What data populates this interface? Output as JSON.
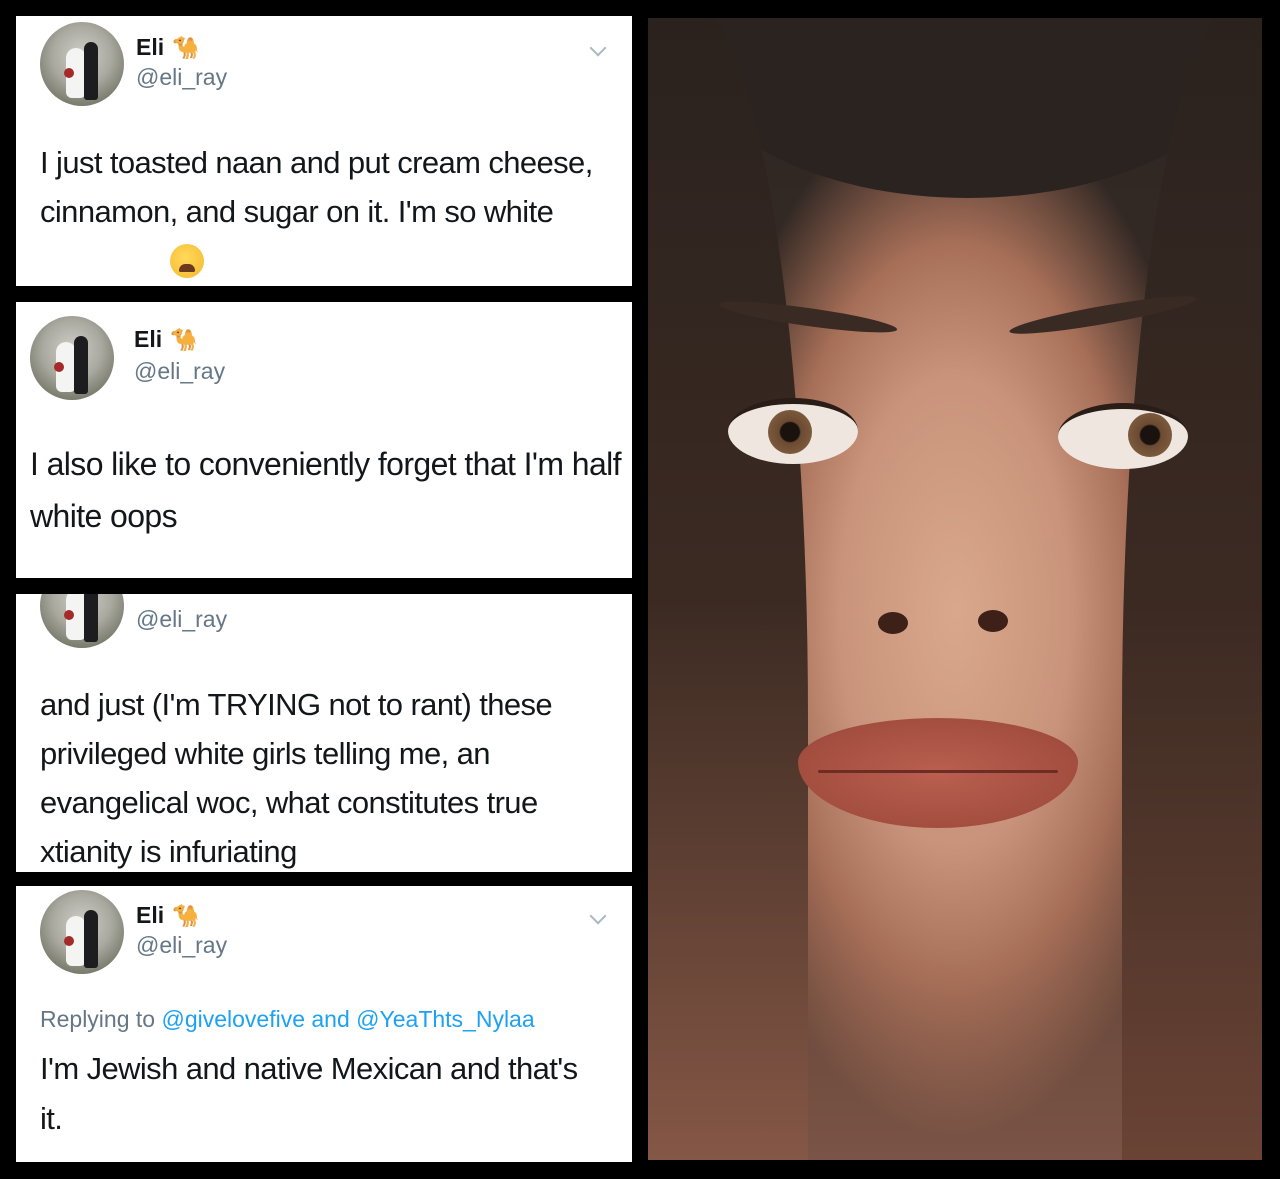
{
  "tweets": [
    {
      "name": "Eli",
      "camel": "🐪",
      "handle": "@eli_ray",
      "text": "I just toasted naan and put cream cheese, cinnamon, and sugar on it. I'm so white"
    },
    {
      "name": "Eli",
      "camel": "🐪",
      "handle": "@eli_ray",
      "text": "I also like to conveniently forget that I'm half white oops"
    },
    {
      "handle": "@eli_ray",
      "text": "and just (I'm TRYING not to rant) these privileged white girls telling me, an evangelical woc, what constitutes true xtianity is infuriating"
    },
    {
      "name": "Eli",
      "camel": "🐪",
      "handle": "@eli_ray",
      "reply_prefix": "Replying to",
      "reply_user1": "@givelovefive",
      "reply_and": "and",
      "reply_user2": "@YeaThts_Nylaa",
      "text": "I'm Jewish and native Mexican and that's it."
    }
  ],
  "colors": {
    "background": "#000000",
    "card": "#ffffff",
    "text": "#14171a",
    "muted": "#657786",
    "link": "#1da1f2"
  }
}
